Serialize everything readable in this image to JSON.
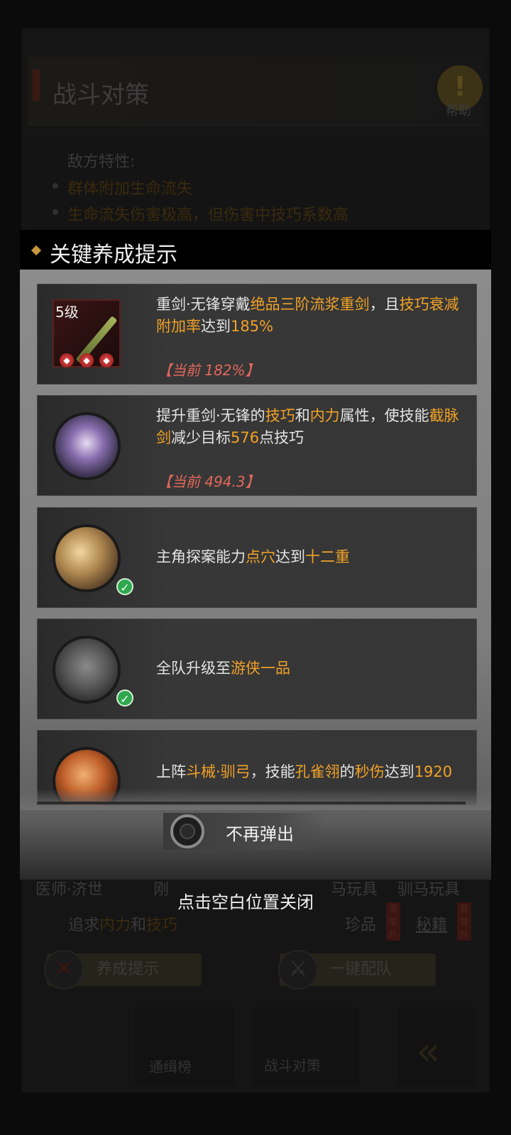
{
  "background": {
    "title": "战斗对策",
    "help_label": "帮助",
    "traits_title": "敌方特性:",
    "traits": [
      "群体附加生命流失",
      "生命流失伤害极高，但伤害中技巧系数高"
    ],
    "row1": {
      "left": "医师·济世",
      "mid": "刚",
      "right_a": "驯马玩具",
      "right_b": "驯马玩具",
      "hidden_a": "马玩具"
    },
    "row2": {
      "prefix": "追求",
      "hl1": "内力",
      "mid": "和",
      "hl2": "技巧",
      "tag_a": "珍品",
      "tag_b": "秘籍",
      "badge": "需提升"
    },
    "btn_cultivate": "养成提示",
    "btn_team": "一键配队",
    "nav": [
      "通缉榜",
      "战斗对策"
    ]
  },
  "popup": {
    "title": "关键养成提示",
    "cards": [
      {
        "level": "5级",
        "t1": "重剑·无锋穿戴",
        "h1": "绝品三阶流浆重剑",
        "t2": "，且",
        "h2": "技巧衰减附加率",
        "t3": "达到",
        "h3": "185%",
        "current": "【当前 182%】"
      },
      {
        "t1": "提升重剑·无锋的",
        "h1": "技巧",
        "t2": "和",
        "h2": "内力",
        "t3": "属性，使技能",
        "h3": "截脉剑",
        "t4": "减少目标",
        "h4": "576",
        "t5": "点技巧",
        "current": "【当前 494.3】"
      },
      {
        "t1": "主角探案能力",
        "h1": "点穴",
        "t2": "达到",
        "h2": "十二重"
      },
      {
        "t1": "全队升级至",
        "h1": "游侠一品"
      },
      {
        "t1": "上阵",
        "h1": "斗械·驯弓",
        "t2": "，技能",
        "h2": "孔雀翎",
        "t3": "的",
        "h3": "秒伤",
        "t4": "达到",
        "h4": "1920"
      }
    ],
    "no_show_label": "不再弹出",
    "close_hint": "点击空白位置关闭"
  },
  "colors": {
    "highlight": "#f2a227",
    "current": "#e4685c",
    "check": "#2fa84f"
  }
}
